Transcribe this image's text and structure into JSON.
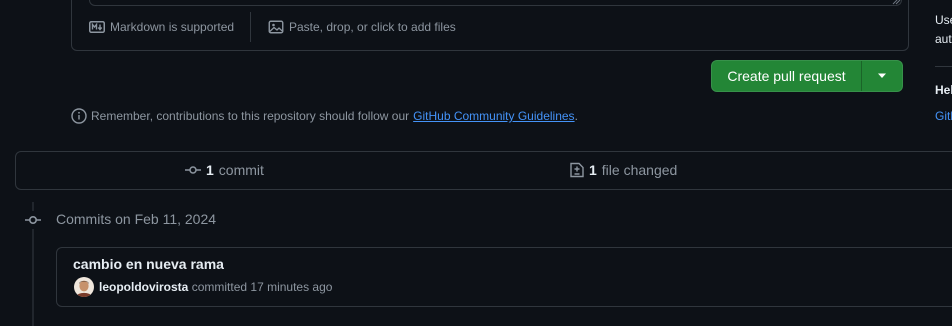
{
  "composer": {
    "markdown_label": "Markdown is supported",
    "attach_label": "Paste, drop, or click to add files"
  },
  "create_pr": {
    "label": "Create pull request",
    "accent": "#238636"
  },
  "guideline": {
    "text_before": "Remember, contributions to this repository should follow our",
    "link_text": "GitHub Community Guidelines",
    "text_after": "."
  },
  "summary": {
    "commit_count": "1",
    "commit_label": "commit",
    "files_count": "1",
    "files_label": "file changed"
  },
  "commits": {
    "date_heading": "Commits on Feb 11, 2024",
    "items": [
      {
        "title": "cambio en nueva rama",
        "author": "leopoldovirosta",
        "action": "committed",
        "time": "17 minutes ago"
      }
    ]
  },
  "sidebar": {
    "line1": "Use",
    "line2": "aut",
    "help_heading": "Hel",
    "help_link": "Gith"
  }
}
